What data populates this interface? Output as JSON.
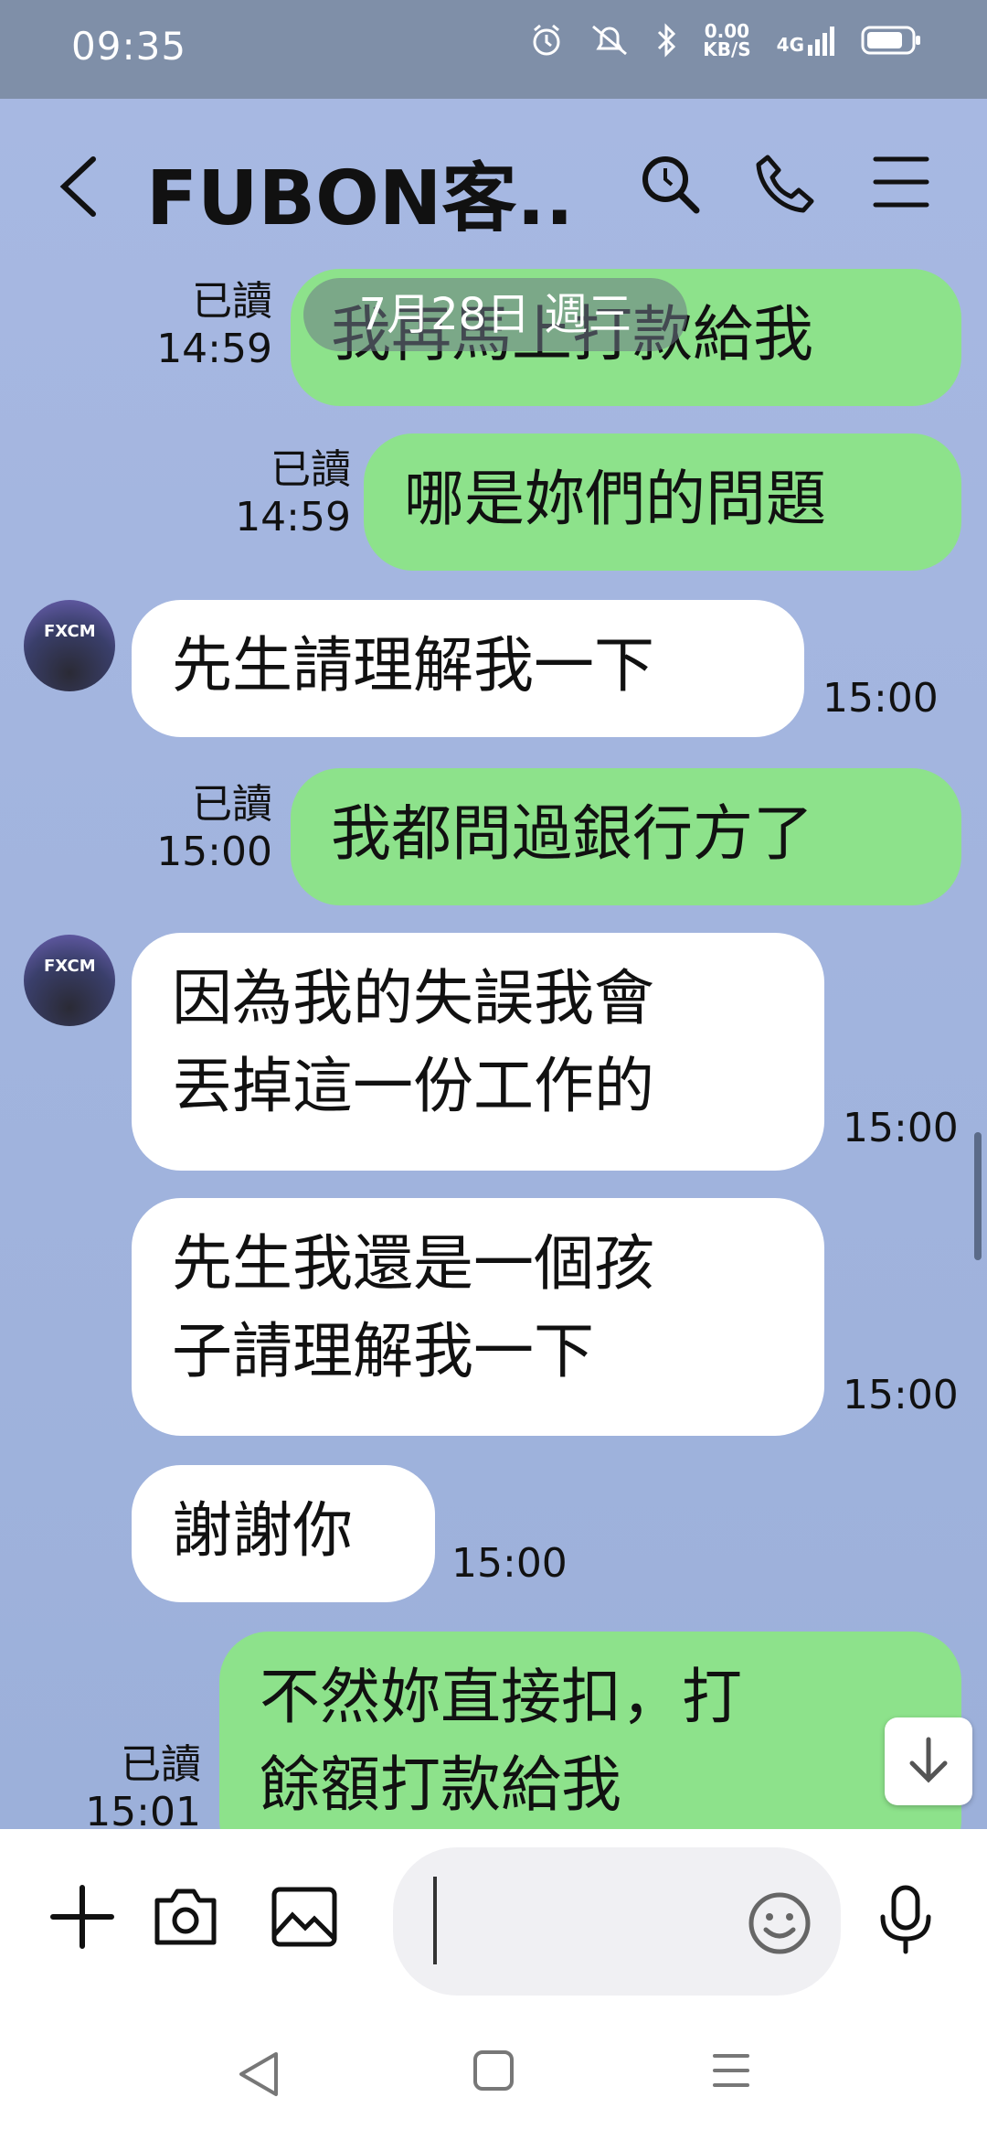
{
  "status_bar": {
    "time": "09:35",
    "speed_value": "0.00",
    "speed_unit": "KB/S",
    "network": "4G"
  },
  "header": {
    "title": "FUBON客..."
  },
  "date_chip": "7月28日 週三",
  "messages": [
    {
      "dir": "out",
      "text": "我再馬上打款給我",
      "read": "已讀",
      "time": "14:59"
    },
    {
      "dir": "out",
      "text": "哪是妳們的問題",
      "read": "已讀",
      "time": "14:59"
    },
    {
      "dir": "in",
      "text": "先生請理解我一下",
      "time": "15:00"
    },
    {
      "dir": "out",
      "text": "我都問過銀行方了",
      "read": "已讀",
      "time": "15:00"
    },
    {
      "dir": "in",
      "text": "因為我的失誤我會\n丟掉這一份工作的",
      "time": "15:00"
    },
    {
      "dir": "in",
      "text": "先生我還是一個孩\n子請理解我一下",
      "time": "15:00"
    },
    {
      "dir": "in",
      "text": "謝謝你",
      "time": "15:00"
    },
    {
      "dir": "out",
      "text": "不然妳直接扣，打\n餘額打款給我",
      "read": "已讀",
      "time": "15:01"
    }
  ],
  "avatar_logo": "FXCM",
  "colors": {
    "outgoing_bubble": "#8de28b",
    "incoming_bubble": "#ffffff",
    "chat_background": "#a7b8e2",
    "status_bar": "#7f8fa8"
  },
  "icons": {
    "header": [
      "back-icon",
      "search-icon",
      "phone-icon",
      "menu-icon"
    ],
    "composer": [
      "plus-icon",
      "camera-icon",
      "image-icon",
      "emoji-icon",
      "microphone-icon"
    ],
    "nav": [
      "nav-back-icon",
      "nav-home-icon",
      "nav-recents-icon"
    ]
  }
}
